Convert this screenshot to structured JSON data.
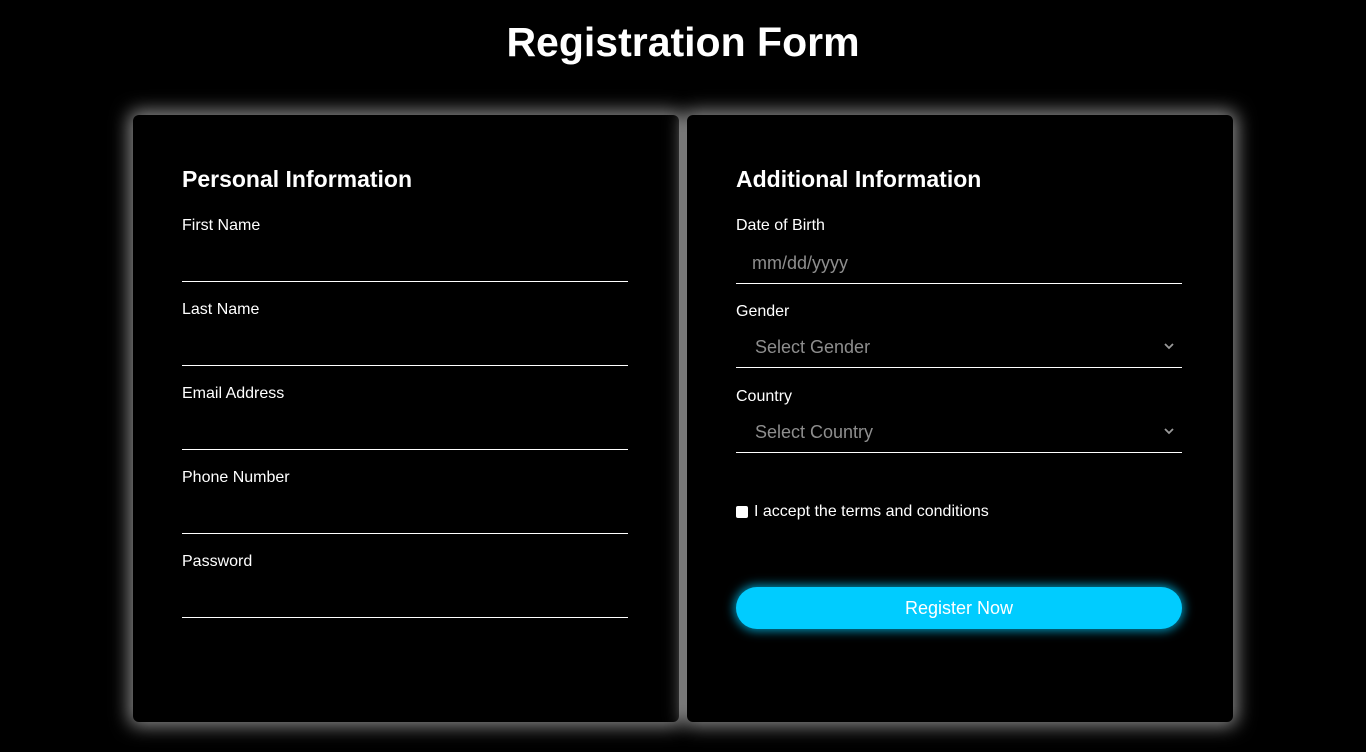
{
  "page": {
    "title": "Registration Form"
  },
  "personal": {
    "heading": "Personal Information",
    "fields": [
      {
        "label": "First Name",
        "value": ""
      },
      {
        "label": "Last Name",
        "value": ""
      },
      {
        "label": "Email Address",
        "value": ""
      },
      {
        "label": "Phone Number",
        "value": ""
      },
      {
        "label": "Password",
        "value": ""
      }
    ]
  },
  "additional": {
    "heading": "Additional Information",
    "dob": {
      "label": "Date of Birth",
      "placeholder": "mm/dd/yyyy"
    },
    "gender": {
      "label": "Gender",
      "selected": "Select Gender"
    },
    "country": {
      "label": "Country",
      "selected": "Select Country"
    },
    "terms": {
      "label": "I accept the terms and conditions",
      "checked": false
    },
    "submit_label": "Register Now"
  },
  "colors": {
    "background": "#000000",
    "text": "#ffffff",
    "accent": "#00ccff",
    "placeholder": "#8e8e8e"
  },
  "icons": [
    "chevron-down-icon",
    "checkbox-icon"
  ]
}
